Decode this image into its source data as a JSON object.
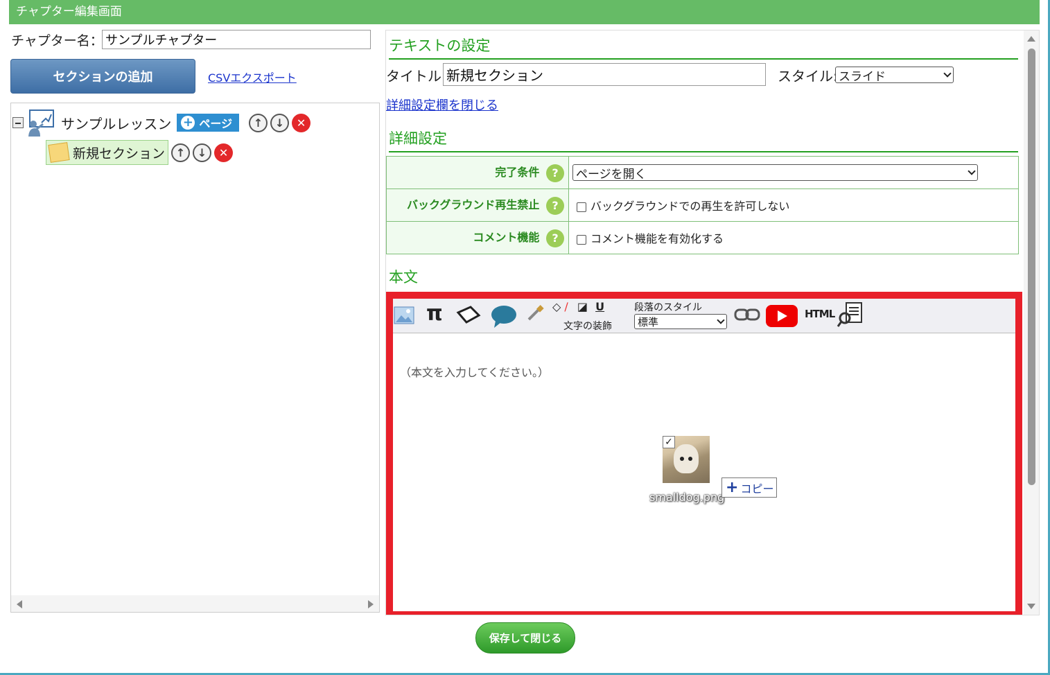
{
  "window": {
    "title": "チャプター編集画面"
  },
  "chapter": {
    "label": "チャプター名：",
    "value": "サンプルチャプター"
  },
  "left": {
    "add_section_label": "セクションの追加",
    "csv_export_label": "CSVエクスポート",
    "tree": {
      "lesson_label": "サンプルレッスン",
      "page_button_label": "ページ",
      "section_label": "新規セクション"
    }
  },
  "right": {
    "text_settings_heading": "テキストの設定",
    "title_label": "タイトル:",
    "title_value": "新規セクション",
    "style_label": "スタイル:",
    "style_value": "スライド",
    "detail_toggle_label": "詳細設定欄を閉じる",
    "detail_heading": "詳細設定",
    "detail_rows": [
      {
        "label": "完了条件",
        "value": "ページを開く"
      },
      {
        "label": "バックグラウンド再生禁止",
        "value": "バックグラウンドでの再生を許可しない"
      },
      {
        "label": "コメント機能",
        "value": "コメント機能を有効化する"
      }
    ],
    "body_heading": "本文",
    "editor": {
      "para_style_label": "段落のスタイル",
      "para_style_value": "標準",
      "text_deco_label": "文字の装飾",
      "html_label": "HTML",
      "placeholder": "（本文を入力してください。）",
      "image_filename": "smalldog.png",
      "copy_tooltip": "コピー"
    }
  },
  "footer": {
    "save_close_label": "保存して閉じる"
  },
  "colors": {
    "accent_green": "#66bb66",
    "frame_red": "#e8202a",
    "link_blue": "#1a33cc"
  }
}
